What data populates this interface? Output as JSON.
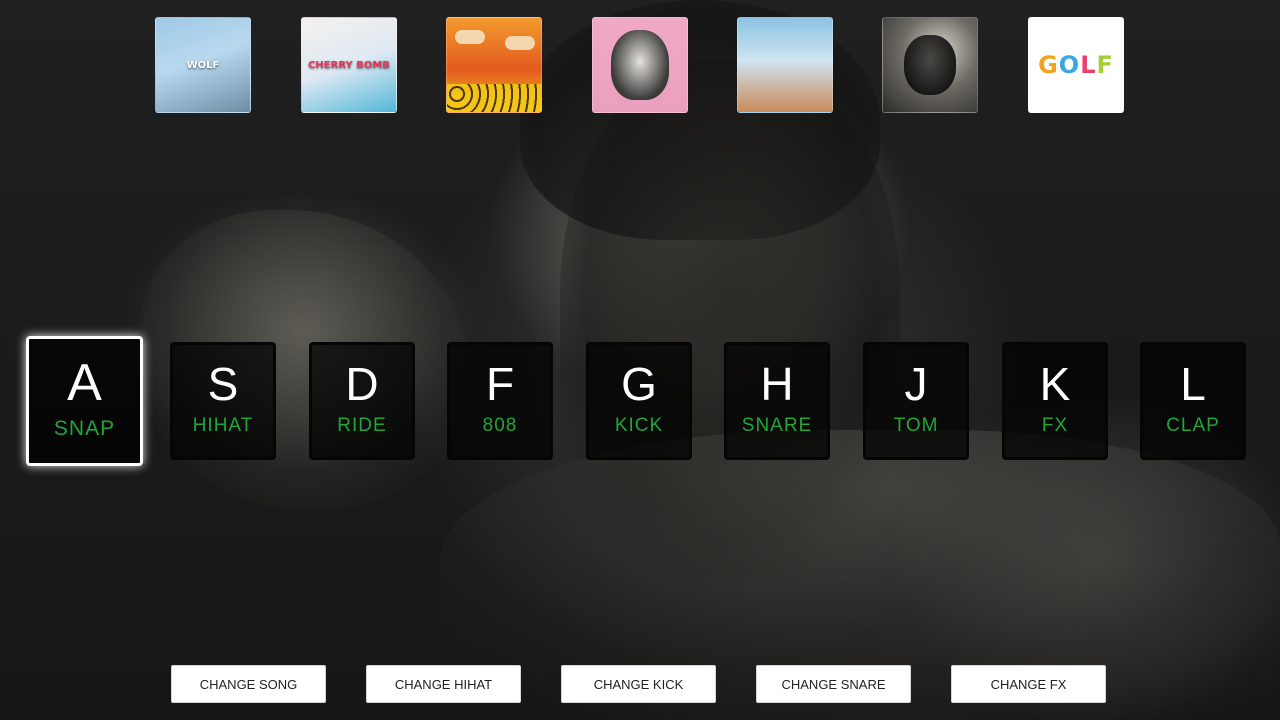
{
  "albums": [
    {
      "art": "WOLF",
      "name": "wolf"
    },
    {
      "art": "CHERRY BOMB",
      "name": "cherry-bomb"
    },
    {
      "art": "",
      "name": "flower-boy"
    },
    {
      "art": "",
      "name": "igor"
    },
    {
      "art": "",
      "name": "call-me-if-you-get-lost"
    },
    {
      "art": "",
      "name": "chromakopia"
    },
    {
      "art": "GOLF",
      "name": "golf"
    }
  ],
  "pads": [
    {
      "key": "A",
      "sound": "SNAP",
      "active": true
    },
    {
      "key": "S",
      "sound": "HIHAT"
    },
    {
      "key": "D",
      "sound": "RIDE"
    },
    {
      "key": "F",
      "sound": "808"
    },
    {
      "key": "G",
      "sound": "KICK"
    },
    {
      "key": "H",
      "sound": "SNARE"
    },
    {
      "key": "J",
      "sound": "TOM"
    },
    {
      "key": "K",
      "sound": "FX"
    },
    {
      "key": "L",
      "sound": "CLAP"
    }
  ],
  "controls": {
    "change_song": "CHANGE SONG",
    "change_hihat": "CHANGE HIHAT",
    "change_kick": "CHANGE KICK",
    "change_snare": "CHANGE SNARE",
    "change_fx": "CHANGE FX"
  },
  "colors": {
    "sound_label": "#1fa637",
    "active_border": "#ffffff",
    "pad_background": "#000000"
  }
}
